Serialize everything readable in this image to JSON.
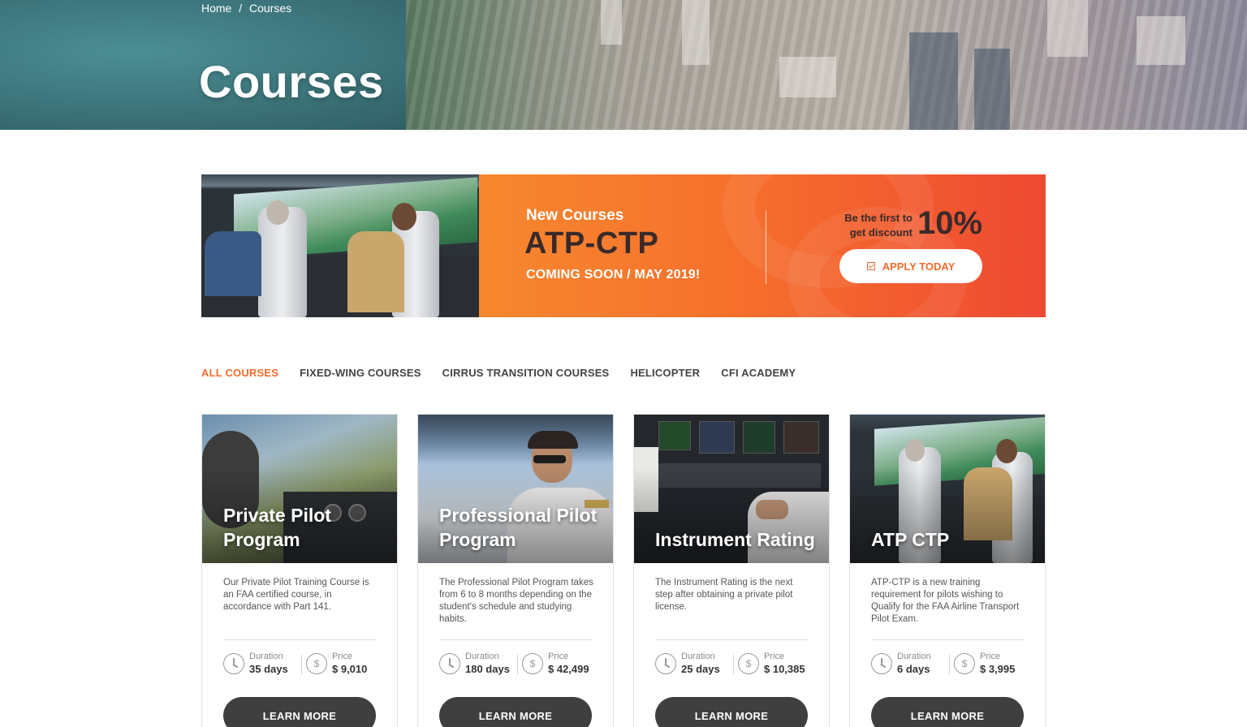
{
  "breadcrumb": {
    "home": "Home",
    "separator": "/",
    "current": "Courses"
  },
  "hero": {
    "title": "Courses"
  },
  "banner": {
    "kicker": "New Courses",
    "title": "ATP-CTP",
    "subtitle": "COMING SOON / MAY 2019!",
    "discount_line1": "Be the first to",
    "discount_line2": "get discount",
    "discount_value": "10%",
    "apply_label": "APPLY TODAY",
    "accent_color": "#f26b2d"
  },
  "tabs": [
    {
      "label": "ALL COURSES",
      "active": true
    },
    {
      "label": "FIXED-WING COURSES",
      "active": false
    },
    {
      "label": "CIRRUS TRANSITION COURSES",
      "active": false
    },
    {
      "label": "HELICOPTER",
      "active": false
    },
    {
      "label": "CFI ACADEMY",
      "active": false
    }
  ],
  "courses": [
    {
      "title": "Private Pilot Program",
      "description": "Our Private Pilot Training Course is an FAA certified course, in accordance with Part 141.",
      "duration_label": "Duration",
      "duration": "35 days",
      "price_label": "Price",
      "price": "$ 9,010",
      "button": "LEARN MORE"
    },
    {
      "title": "Professional Pilot Program",
      "description": "The Professional Pilot Program takes from 6 to 8 months depending on the student's schedule and studying habits.",
      "duration_label": "Duration",
      "duration": "180 days",
      "price_label": "Price",
      "price": "$ 42,499",
      "button": "LEARN MORE"
    },
    {
      "title": "Instrument Rating",
      "description": "The Instrument Rating is the next step after obtaining a private pilot license.",
      "duration_label": "Duration",
      "duration": "25 days",
      "price_label": "Price",
      "price": "$ 10,385",
      "button": "LEARN MORE"
    },
    {
      "title": "ATP CTP",
      "description": "ATP-CTP is a new training requirement for pilots wishing to Qualify for the FAA Airline Transport Pilot Exam.",
      "duration_label": "Duration",
      "duration": "6 days",
      "price_label": "Price",
      "price": "$ 3,995",
      "button": "LEARN MORE"
    }
  ],
  "icons": {
    "duration": "clock-icon",
    "price": "dollar-circle-icon",
    "apply": "checkbox-icon",
    "dollar_glyph": "$"
  }
}
